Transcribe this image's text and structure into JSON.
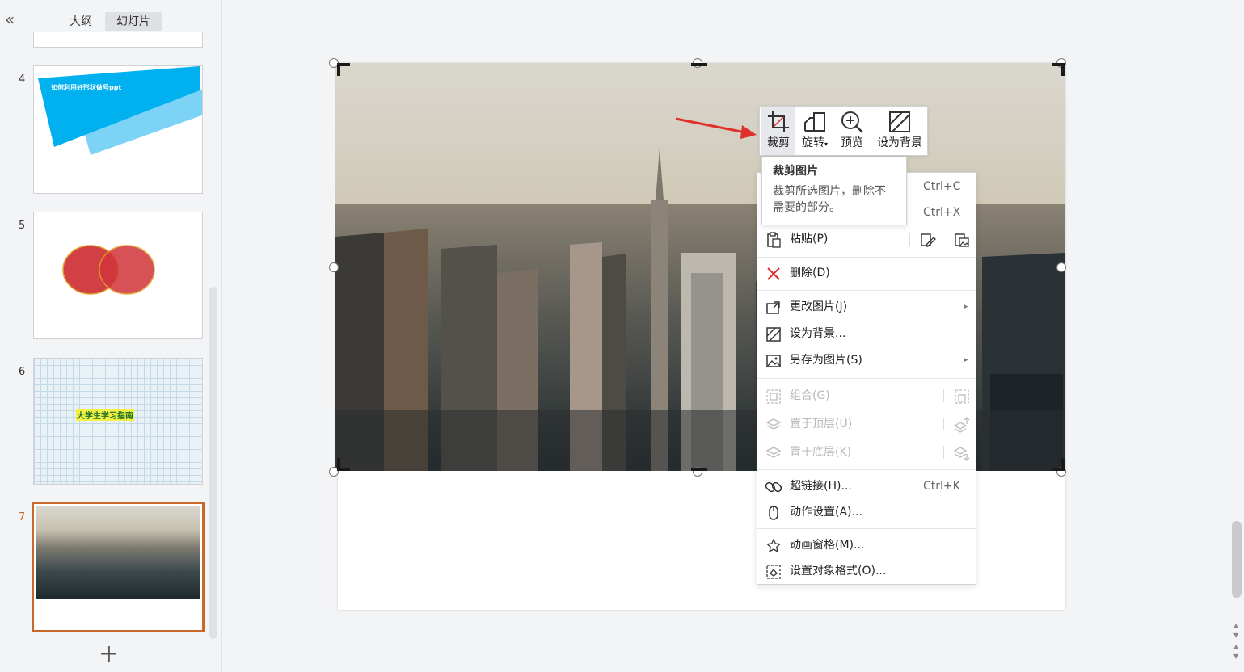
{
  "panel": {
    "collapse_icon": "double-chevron-left-icon",
    "tabs": [
      {
        "label": "大纲"
      },
      {
        "label": "幻灯片"
      }
    ],
    "slides": [
      {
        "number": "4",
        "text": "如何利用好形状做号ppt"
      },
      {
        "number": "5"
      },
      {
        "number": "6",
        "text": "大学生学习指南"
      },
      {
        "number": "7",
        "selected": true
      }
    ],
    "add_icon": "plus-icon"
  },
  "toolbar": {
    "items": [
      {
        "label": "裁剪",
        "icon": "crop-icon"
      },
      {
        "label": "旋转",
        "icon": "rotate-icon"
      },
      {
        "label": "预览",
        "icon": "zoom-in-icon"
      },
      {
        "label": "设为背景",
        "icon": "set-background-icon"
      }
    ]
  },
  "tooltip": {
    "title": "裁剪图片",
    "body": "裁剪所选图片，删除不需要的部分。"
  },
  "menu": {
    "copy_shortcut": "Ctrl+C",
    "cut_shortcut": "Ctrl+X",
    "paste": "粘贴(P)",
    "delete": "删除(D)",
    "change_picture": "更改图片(J)",
    "set_background": "设为背景...",
    "save_as_picture": "另存为图片(S)",
    "group": "组合(G)",
    "bring_to_front": "置于顶层(U)",
    "send_to_back": "置于底层(K)",
    "hyperlink": "超链接(H)...",
    "hyperlink_shortcut": "Ctrl+K",
    "action_settings": "动作设置(A)...",
    "animation_pane": "动画窗格(M)...",
    "format_object": "设置对象格式(O)..."
  },
  "colors": {
    "accent": "#c8682b",
    "arrow": "#e0302a",
    "delete_icon": "#d9332b",
    "slide4_blue": "#00b0ef",
    "slide5_red": "#d0353a"
  }
}
